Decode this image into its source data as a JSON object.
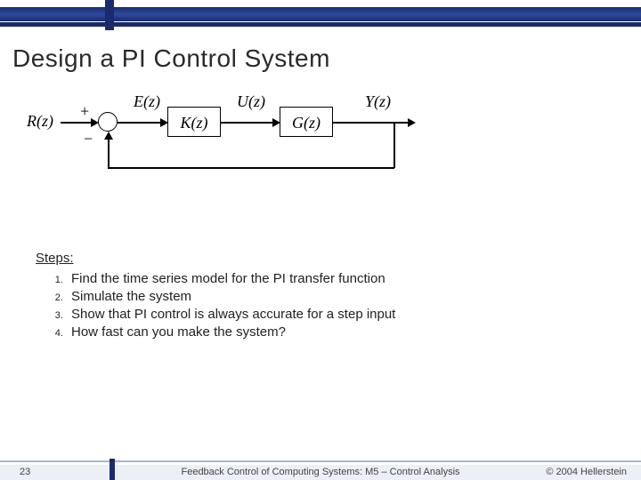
{
  "title": "Design a PI Control System",
  "diagram": {
    "signals": {
      "r": "R(z)",
      "e": "E(z)",
      "u": "U(z)",
      "y": "Y(z)"
    },
    "blocks": {
      "controller": "K(z)",
      "plant": "G(z)"
    },
    "sum": {
      "plus": "+",
      "minus": "−"
    }
  },
  "steps": {
    "heading": "Steps:",
    "items": [
      "Find the time series model for the PI transfer function",
      "Simulate the system",
      "Show that PI control is always accurate for a step input",
      "How fast can you make the system?"
    ]
  },
  "footer": {
    "page": "23",
    "center": "Feedback Control of Computing Systems: M5 – Control Analysis",
    "right": "© 2004 Hellerstein"
  }
}
